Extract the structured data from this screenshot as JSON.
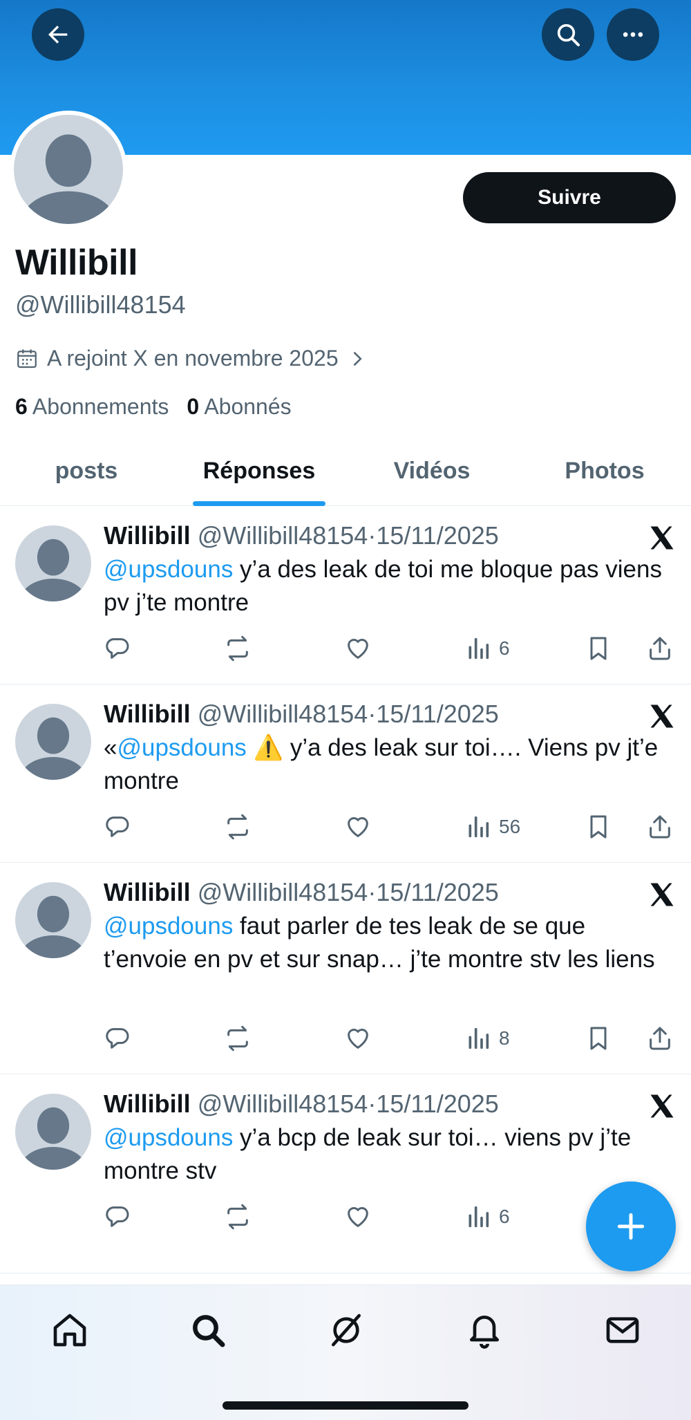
{
  "header": {
    "back_icon": "arrow-left-icon",
    "search_icon": "search-icon",
    "more_icon": "more-horizontal-icon",
    "banner_color": "#1d9bf0"
  },
  "profile": {
    "name": "Willibill",
    "handle": "@Willibill48154",
    "follow_label": "Suivre",
    "joined": "A rejoint X en novembre 2025",
    "following_count": "6",
    "following_label": "Abonnements",
    "followers_count": "0",
    "followers_label": "Abonnés"
  },
  "tabs": [
    {
      "label": "posts",
      "active": false
    },
    {
      "label": "Réponses",
      "active": true
    },
    {
      "label": "Vidéos",
      "active": false
    },
    {
      "label": "Photos",
      "active": false
    }
  ],
  "posts": [
    {
      "name": "Willibill",
      "handle": "@Willibill48154",
      "sep": "·",
      "date": "15/11/2025",
      "prefix": "",
      "mention": "@upsdouns",
      "text": " y’a des leak de toi me bloque pas viens pv j’te montre",
      "views": "6"
    },
    {
      "name": "Willibill",
      "handle": "@Willibill48154",
      "sep": "·",
      "date": "15/11/2025",
      "prefix": "«",
      "mention": "@upsdouns",
      "text": " ⚠️ y’a des leak sur toi…. Viens pv jt’e montre",
      "views": "56"
    },
    {
      "name": "Willibill",
      "handle": "@Willibill48154",
      "sep": "·",
      "date": "15/11/2025",
      "prefix": "",
      "mention": "@upsdouns",
      "text": " faut parler de tes leak de se que t’envoie en pv et sur snap… j’te montre stv les liens",
      "views": "8"
    },
    {
      "name": "Willibill",
      "handle": "@Willibill48154",
      "sep": "·",
      "date": "15/11/2025",
      "prefix": "",
      "mention": "@upsdouns",
      "text": " y’a bcp de leak sur toi… viens pv j’te montre stv",
      "views": "6"
    }
  ],
  "colors": {
    "accent": "#1d9bf0",
    "text": "#0f1419",
    "muted": "#536471"
  },
  "nav": [
    "home-icon",
    "search-icon",
    "grok-icon",
    "bell-icon",
    "mail-icon"
  ]
}
